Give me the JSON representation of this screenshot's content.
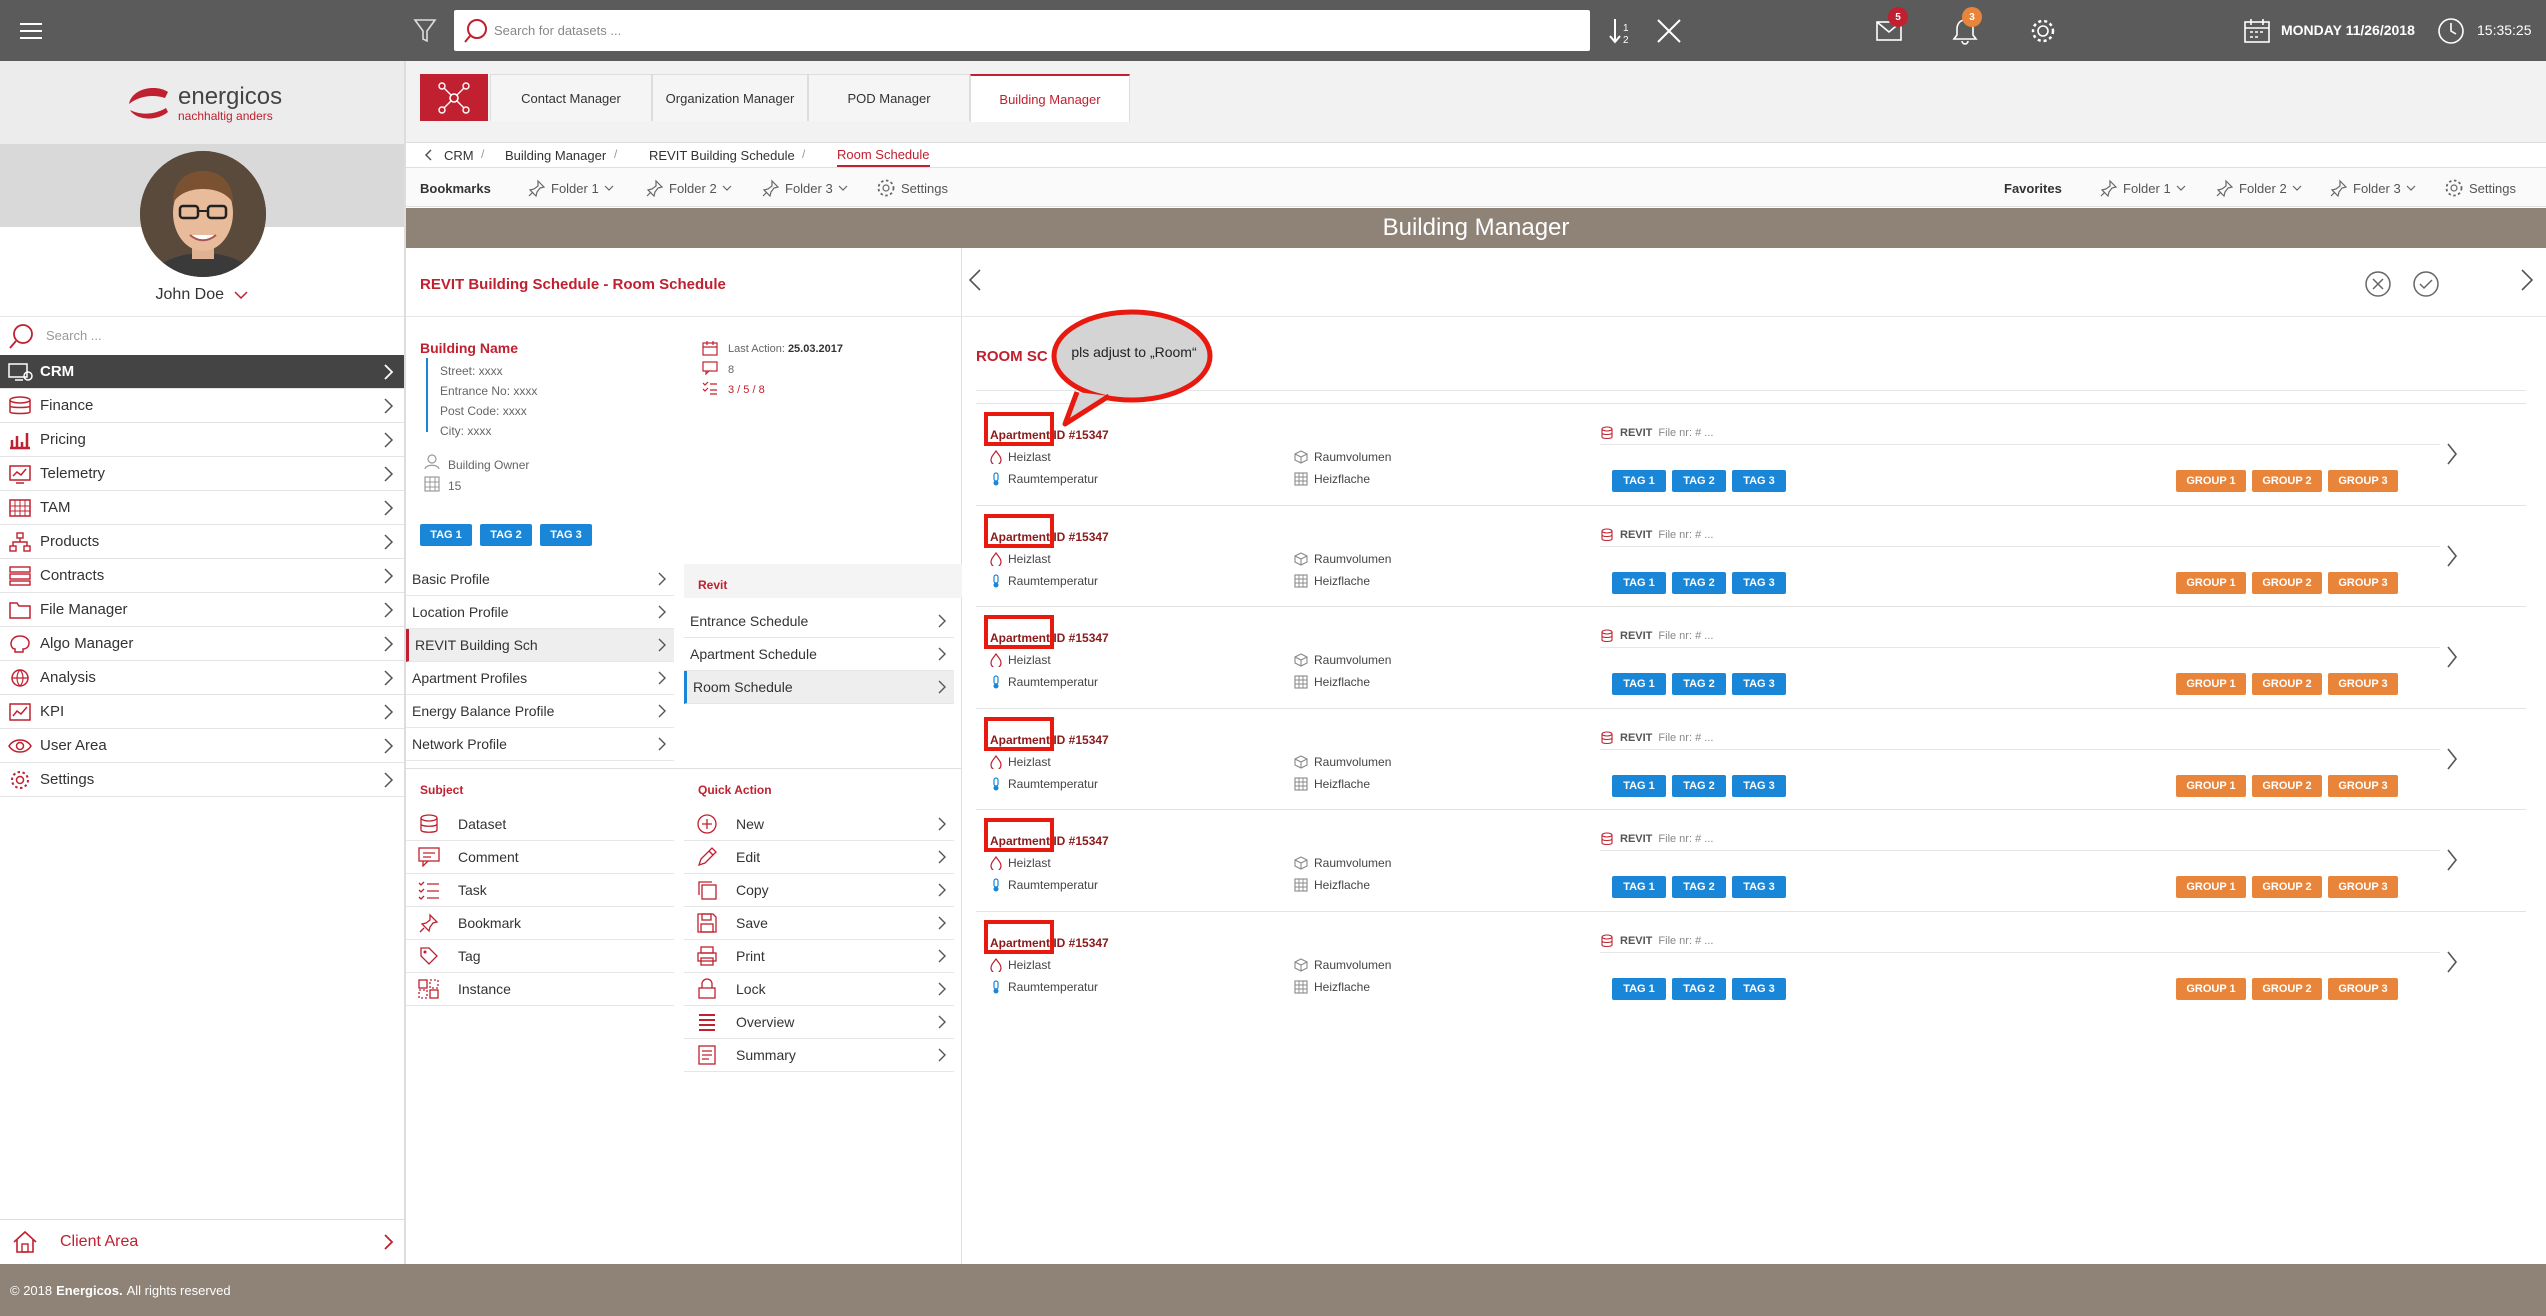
{
  "topbar": {
    "search_placeholder": "Search for datasets ...",
    "mail_count": "5",
    "notif_count": "3",
    "date": "MONDAY 11/26/2018",
    "time": "15:35:25"
  },
  "sidebar": {
    "brand": "energicos",
    "brand_tagline": "nachhaltig anders",
    "user_name": "John Doe",
    "search_placeholder": "Search ...",
    "items": [
      {
        "label": "CRM",
        "icon": "crm-icon"
      },
      {
        "label": "Finance",
        "icon": "database-icon"
      },
      {
        "label": "Pricing",
        "icon": "bar-chart-icon"
      },
      {
        "label": "Telemetry",
        "icon": "monitor-chart-icon"
      },
      {
        "label": "TAM",
        "icon": "grid-icon"
      },
      {
        "label": "Products",
        "icon": "network-icon"
      },
      {
        "label": "Contracts",
        "icon": "contracts-icon"
      },
      {
        "label": "File Manager",
        "icon": "folder-icon"
      },
      {
        "label": "Algo Manager",
        "icon": "brain-icon"
      },
      {
        "label": "Analysis",
        "icon": "globe-icon"
      },
      {
        "label": "KPI",
        "icon": "kpi-icon"
      },
      {
        "label": "User Area",
        "icon": "eye-icon"
      },
      {
        "label": "Settings",
        "icon": "gear-icon"
      }
    ],
    "client_area": "Client Area"
  },
  "tabs": [
    "Contact Manager",
    "Organization Manager",
    "POD Manager",
    "Building Manager"
  ],
  "breadcrumb": [
    "CRM",
    "Building Manager",
    "REVIT Building Schedule",
    "Room Schedule"
  ],
  "bookmarks": {
    "label": "Bookmarks",
    "folders": [
      "Folder 1",
      "Folder 2",
      "Folder 3"
    ],
    "settings": "Settings",
    "favorites_label": "Favorites"
  },
  "page_title": "Building Manager",
  "left": {
    "title": "REVIT Building Schedule - Room Schedule",
    "building_name": "Building Name",
    "address": [
      "Street: xxxx",
      "Entrance No: xxxx",
      "Post Code: xxxx",
      "City: xxxx"
    ],
    "owner_label": "Building Owner",
    "owner_count": "15",
    "last_action_label": "Last Action:",
    "last_action_date": "25.03.2017",
    "comments": "8",
    "tasks": "3 / 5 / 8",
    "tags": [
      "TAG 1",
      "TAG 2",
      "TAG 3"
    ],
    "profiles": [
      "Basic Profile",
      "Location Profile",
      "REVIT Building Sch",
      "Apartment Profiles",
      "Energy Balance Profile",
      "Network Profile"
    ],
    "revit_heading": "Revit",
    "revit_items": [
      "Entrance Schedule",
      "Apartment Schedule",
      "Room Schedule"
    ],
    "subject_heading": "Subject",
    "subjects": [
      "Dataset",
      "Comment",
      "Task",
      "Bookmark",
      "Tag",
      "Instance"
    ],
    "quick_heading": "Quick Action",
    "quick_actions": [
      "New",
      "Edit",
      "Copy",
      "Save",
      "Print",
      "Lock",
      "Overview",
      "Summary"
    ]
  },
  "right": {
    "section_heading": "ROOM SC",
    "callout": "pls adjust to „Room“",
    "row_template": {
      "apartment_id": "Apartment ID #15347",
      "heizlast": "Heizlast",
      "raumtemperatur": "Raumtemperatur",
      "raumvolumen": "Raumvolumen",
      "heizflache": "Heizflache",
      "revit": "REVIT",
      "file_nr": "File nr: # ...",
      "tags": [
        "TAG 1",
        "TAG 2",
        "TAG 3"
      ],
      "groups": [
        "GROUP 1",
        "GROUP 2",
        "GROUP 3"
      ]
    }
  },
  "footer": {
    "prefix": "© 2018 ",
    "brand": "Energicos.",
    "suffix": " All rights reserved"
  },
  "colors": {
    "accent": "#c0202f",
    "topbar": "#5b5b5b",
    "band": "#8f8276",
    "tag_blue": "#1a86d8",
    "group_orange": "#e8853a"
  }
}
